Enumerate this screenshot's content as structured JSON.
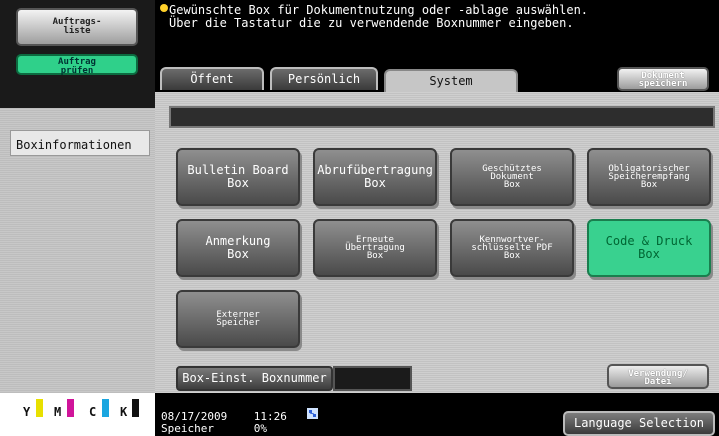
{
  "sidebar": {
    "auftragsliste": "Auftrags-\nliste",
    "auftrag_pruefen": "Auftrag\nprüfen",
    "boxinformationen": "Boxinformationen"
  },
  "header": {
    "message_line1": "Gewünschte Box für Dokumentnutzung oder -ablage auswählen.",
    "message_line2": "Über die Tastatur die zu verwendende Boxnummer eingeben."
  },
  "tabs": [
    {
      "label": "Öffent"
    },
    {
      "label": "Persönlich"
    },
    {
      "label": "System",
      "active": true
    }
  ],
  "dokument_speichern": "Dokument\nspeichern",
  "boxes": [
    {
      "label": "Bulletin Board\nBox"
    },
    {
      "label": "Abrufübertragung\nBox"
    },
    {
      "label": "Geschütztes\nDokument\nBox"
    },
    {
      "label": "Obligatorischer\nSpeicherempfang\nBox"
    },
    {
      "label": "Anmerkung\nBox"
    },
    {
      "label": "Erneute\nÜbertragung\nBox"
    },
    {
      "label": "Kennwortver-\nschlüsselte PDF\nBox"
    },
    {
      "label": "Code & Druck\nBox"
    },
    {
      "label": "Externer\nSpeicher"
    }
  ],
  "footer_controls": {
    "box_einst": "Box-Einst. Boxnummer",
    "verwendung_datei": "Verwendung/\nDatei"
  },
  "status": {
    "date": "08/17/2009",
    "time": "11:26",
    "memory_label": "Speicher",
    "memory_value": "0%",
    "language_selection": "Language Selection"
  },
  "toner": [
    "Y",
    "M",
    "C",
    "K"
  ],
  "colors": {
    "accent_green": "#39d18f",
    "toner_yellow": "#e8e000",
    "toner_magenta": "#d0149a",
    "toner_cyan": "#1aa6e0",
    "toner_black": "#111111"
  }
}
